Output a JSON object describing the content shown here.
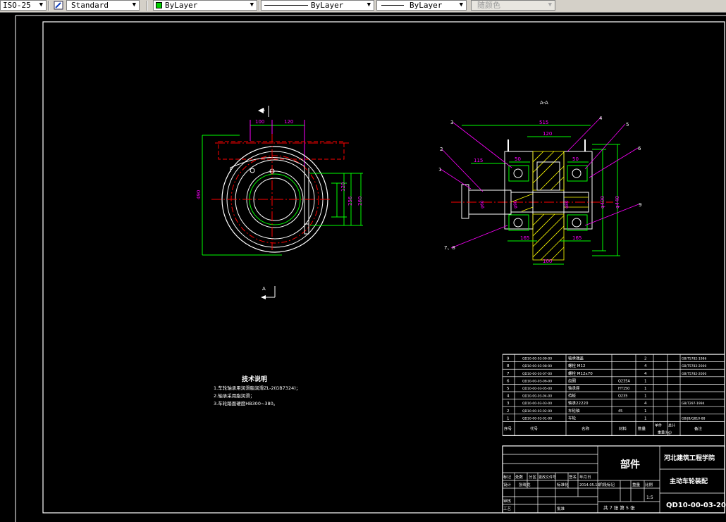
{
  "toolbar": {
    "dimstyle": "ISO-25",
    "textstyle": "Standard",
    "layer": "ByLayer",
    "linetype": "ByLayer",
    "lineweight": "ByLayer",
    "color": "随颜色"
  },
  "colors": {
    "background": "#000000",
    "frame": "#ffffff",
    "dimension": "#00ff00",
    "centerline": "#ff0000",
    "hidden": "#ff0000",
    "dim_text": "#ff00ff",
    "leader": "#ff00ff",
    "section_hatch": "#ffff00",
    "annotation": "#ffffff"
  },
  "view_left": {
    "dims": {
      "d100": "100",
      "d120": "120",
      "d490": "490",
      "d120b": "120",
      "d256": "256",
      "d260": "260"
    },
    "section_marks": {
      "top": "A",
      "bottom": "A"
    }
  },
  "view_right": {
    "title": "A-A",
    "dims": {
      "w515": "515",
      "w120": "120",
      "w115": "115",
      "w50a": "50",
      "w50b": "50",
      "w165a": "165",
      "w165b": "165",
      "w100": "100",
      "phi400": "φ400",
      "phi440": "φ440",
      "phi90": "φ90",
      "phi80": "φ80",
      "phi60": "φ60"
    },
    "leader_numbers": [
      "1",
      "2",
      "3",
      "4",
      "5",
      "6",
      "9",
      "7、8"
    ]
  },
  "tech_notes": {
    "title": "技术说明",
    "lines": [
      "1.车轮轴承用润滑脂润滑ZL-2(GB7324)；",
      "2.轴承采用脂润滑；",
      "3.车轮踏面硬度HB300~380。"
    ]
  },
  "parts_list": {
    "rows": [
      {
        "no": "9",
        "code": "QD10-00-03-09-00",
        "name": "轴承端盖",
        "qty": "2",
        "material": "",
        "std": "GB/T5782-1986"
      },
      {
        "no": "8",
        "code": "QD10-00-03-08-00",
        "name": "螺栓 M12",
        "qty": "4",
        "material": "",
        "std": "GB/T5783-2000"
      },
      {
        "no": "7",
        "code": "QD10-00-03-07-00",
        "name": "螺栓 M12x70",
        "qty": "4",
        "material": "",
        "std": "GB/T5782-2000"
      },
      {
        "no": "6",
        "code": "QD10-00-03-06-00",
        "name": "齿圈",
        "qty": "1",
        "material": "Q235A",
        "std": ""
      },
      {
        "no": "5",
        "code": "QD10-00-03-05-00",
        "name": "轴承座",
        "qty": "1",
        "material": "HT150",
        "std": ""
      },
      {
        "no": "4",
        "code": "QD10-00-03-04-00",
        "name": "挡板",
        "qty": "1",
        "material": "Q235",
        "std": ""
      },
      {
        "no": "3",
        "code": "QD10-00-03-03-00",
        "name": "轴承22220",
        "qty": "4",
        "material": "",
        "std": "GB/T297-1994"
      },
      {
        "no": "2",
        "code": "QD10-00-03-02-00",
        "name": "车轮轴",
        "qty": "1",
        "material": "45",
        "std": ""
      },
      {
        "no": "1",
        "code": "QD10-00-03-01-00",
        "name": "车轮",
        "qty": "1",
        "material": "",
        "std": "GB/JB/Q810-88"
      }
    ],
    "header": {
      "no": "序号",
      "code": "代号",
      "name": "名称",
      "qty": "数量",
      "material": "材料",
      "weight_single": "单件",
      "weight_total": "总计",
      "weight": "重量(kg)",
      "remark": "备注"
    }
  },
  "title_block": {
    "part_type": "部件",
    "school": "河北建筑工程学院",
    "drawing_name": "主动车轮装配",
    "drawing_no": "QD10-00-03-20",
    "scale": "1:5",
    "sheet": "共 7 张 第 5 张",
    "labels": {
      "mark": "标记",
      "count": "处数",
      "zone": "分区",
      "change_doc": "更改文件号",
      "signature": "签名",
      "date": "年月日",
      "design": "设计",
      "designer": "张晓龙",
      "std_check": "标准化",
      "date_val": "2014.05.15",
      "stage": "阶段标记",
      "weight": "重量",
      "ratio": "比例",
      "review": "审核",
      "process": "工艺",
      "approve": "批准"
    }
  }
}
